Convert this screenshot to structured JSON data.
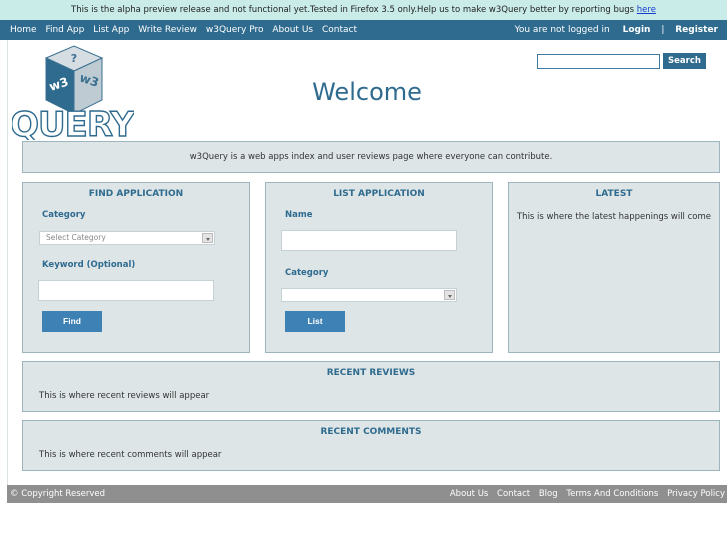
{
  "alpha_notice": {
    "text": "This is the alpha preview release and not functional yet.Tested in Firefox 3.5 only.Help us to make w3Query better by reporting bugs",
    "link_text": "here"
  },
  "nav": {
    "items": [
      "Home",
      "Find App",
      "List App",
      "Write Review",
      "w3Query Pro",
      "About Us",
      "Contact"
    ],
    "status": "You are not logged in",
    "login": "Login",
    "separator": "|",
    "register": "Register"
  },
  "logo": {
    "cube_text_left": "w3",
    "cube_text_right": "w3",
    "cube_text_top": "?",
    "word": "QUERY"
  },
  "search": {
    "value": "",
    "button": "Search"
  },
  "welcome": "Welcome",
  "intro": "w3Query is a web apps index and user reviews page where everyone can contribute.",
  "find_app": {
    "title": "FIND APPLICATION",
    "category_label": "Category",
    "category_select": "Select Category",
    "keyword_label": "Keyword (Optional)",
    "keyword_value": "",
    "button": "Find"
  },
  "list_app": {
    "title": "LIST APPLICATION",
    "name_label": "Name",
    "name_value": "",
    "category_label": "Category",
    "category_select": "",
    "button": "List"
  },
  "latest": {
    "title": "LATEST",
    "text": "This is where the latest happenings will come"
  },
  "recent_reviews": {
    "title": "RECENT REVIEWS",
    "text": "This is where recent reviews will appear"
  },
  "recent_comments": {
    "title": "RECENT COMMENTS",
    "text": "This is where recent comments will appear"
  },
  "footer": {
    "copyright": "© Copyright Reserved",
    "links": [
      "About Us",
      "Contact",
      "Blog",
      "Terms And Conditions",
      "Privacy Policy"
    ]
  },
  "colors": {
    "primary": "#2f6b8f",
    "panel": "#dde5e7",
    "button": "#3e81b5",
    "alpha_bar": "#c9ece9",
    "footer": "#8f8f8f"
  }
}
